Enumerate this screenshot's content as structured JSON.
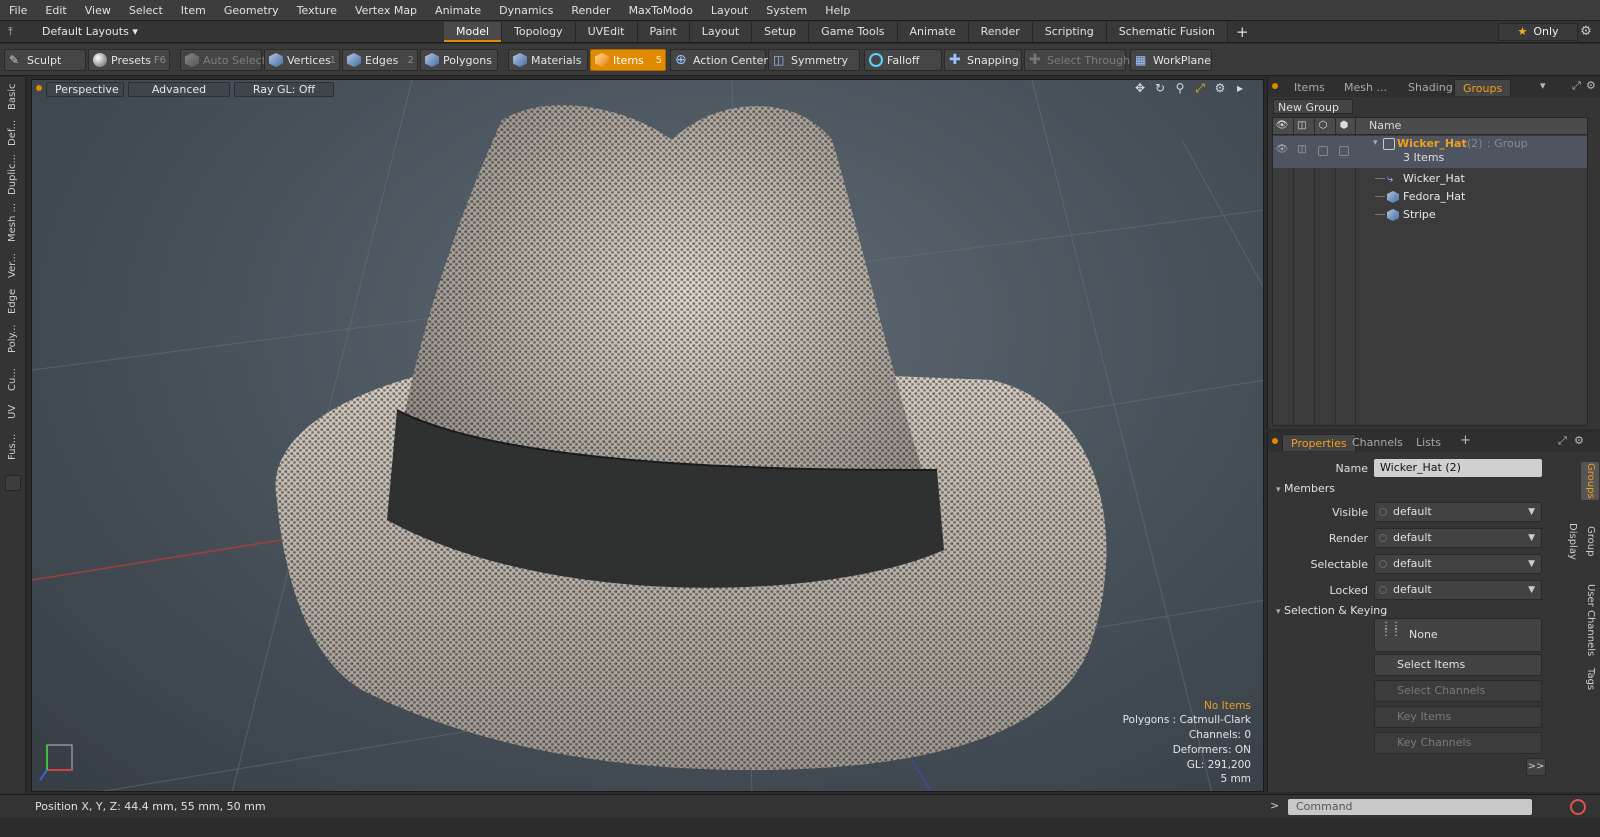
{
  "menu": [
    "File",
    "Edit",
    "View",
    "Select",
    "Item",
    "Geometry",
    "Texture",
    "Vertex Map",
    "Animate",
    "Dynamics",
    "Render",
    "MaxToModo",
    "Layout",
    "System",
    "Help"
  ],
  "layoutbar": {
    "layout_dropdown": "Default Layouts",
    "tabs": [
      "Model",
      "Topology",
      "UVEdit",
      "Paint",
      "Layout",
      "Setup",
      "Game Tools",
      "Animate",
      "Render",
      "Scripting",
      "Schematic Fusion"
    ],
    "active_tab": "Model",
    "only_label": "Only"
  },
  "toolbar": {
    "sculpt": "Sculpt",
    "presets": "Presets",
    "presets_key": "F6",
    "auto_select": "Auto Select",
    "vertices": "Vertices",
    "vertices_key": "1",
    "edges": "Edges",
    "edges_key": "2",
    "polygons": "Polygons",
    "materials": "Materials",
    "items": "Items",
    "items_key": "5",
    "action_center": "Action Center",
    "symmetry": "Symmetry",
    "falloff": "Falloff",
    "snapping": "Snapping",
    "select_through": "Select Through",
    "workplane": "WorkPlane"
  },
  "left_tabs": [
    "Basic",
    "Def...",
    "Duplic...",
    "Mesh ...",
    "Ver...",
    "Edge",
    "Poly...",
    "Cu...",
    "UV",
    "Fus..."
  ],
  "viewport": {
    "view_mode": "Perspective",
    "shading": "Advanced",
    "raygl": "Ray GL: Off",
    "info": {
      "no_items": "No Items",
      "polygons": "Polygons : Catmull-Clark",
      "channels": "Channels: 0",
      "deformers": "Deformers: ON",
      "gl": "GL: 291,200",
      "scale": "5 mm"
    }
  },
  "groups_panel": {
    "tabs": [
      "Items",
      "Mesh ...",
      "Shading",
      "Groups"
    ],
    "active_tab": "Groups",
    "new_group": "New Group",
    "col_name": "Name",
    "group_name": "Wicker_Hat",
    "group_count": "(2)",
    "group_type": ": Group",
    "group_items": "3 Items",
    "children": [
      "Wicker_Hat",
      "Fedora_Hat",
      "Stripe"
    ]
  },
  "properties": {
    "tabs": [
      "Properties",
      "Channels",
      "Lists"
    ],
    "name_label": "Name",
    "name_value": "Wicker_Hat (2)",
    "members_section": "Members",
    "visible_label": "Visible",
    "visible_value": "default",
    "render_label": "Render",
    "render_value": "default",
    "selectable_label": "Selectable",
    "selectable_value": "default",
    "locked_label": "Locked",
    "locked_value": "default",
    "selkey_section": "Selection & Keying",
    "none_btn": "None",
    "select_items": "Select Items",
    "select_channels": "Select Channels",
    "key_items": "Key Items",
    "key_channels": "Key Channels",
    "more": ">>",
    "side_tabs": [
      "Groups",
      "Group Display",
      "User Channels",
      "Tags"
    ]
  },
  "status": {
    "position": "Position X, Y, Z:   44.4 mm, 55 mm, 50 mm",
    "command_placeholder": "Command"
  },
  "colors": {
    "accent": "#e08a00",
    "group_name": "#f0a020"
  }
}
